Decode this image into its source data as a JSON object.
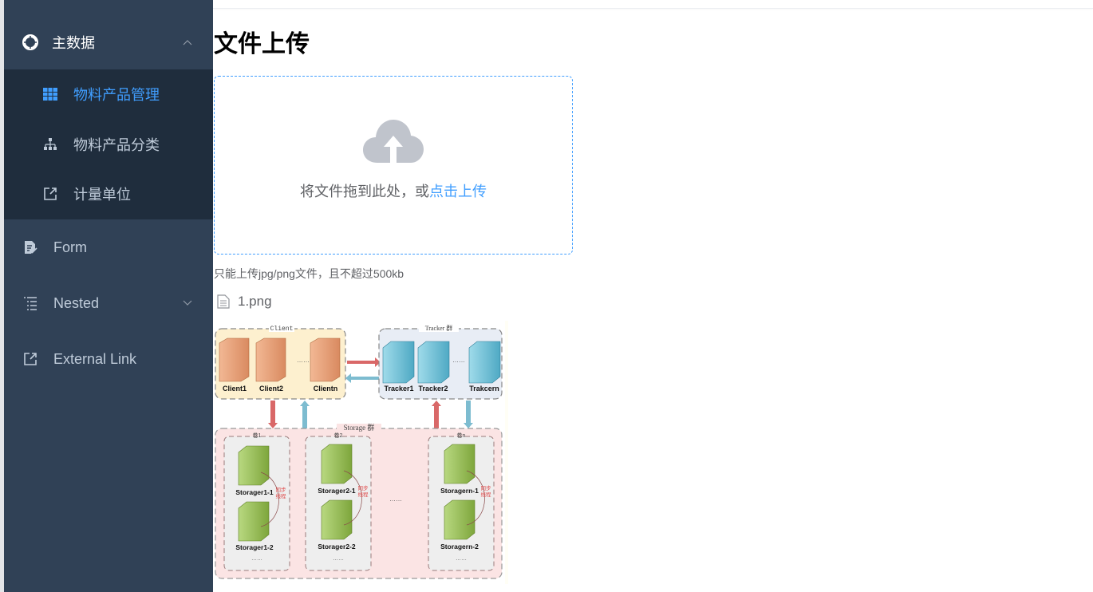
{
  "sidebar": {
    "groups": [
      {
        "label": "主数据",
        "icon": "lifebuoy-icon",
        "expanded": true,
        "children": [
          {
            "label": "物料产品管理",
            "icon": "table-icon",
            "active": true
          },
          {
            "label": "物料产品分类",
            "icon": "tree-icon",
            "active": false
          },
          {
            "label": "计量单位",
            "icon": "external-link-icon",
            "active": false
          }
        ]
      },
      {
        "label": "Form",
        "icon": "form-icon"
      },
      {
        "label": "Nested",
        "icon": "nested-list-icon",
        "expanded": false
      },
      {
        "label": "External Link",
        "icon": "external-link-icon"
      }
    ]
  },
  "main": {
    "title": "文件上传",
    "upload": {
      "drop_text": "将文件拖到此处，或",
      "click_text": "点击上传",
      "tip": "只能上传jpg/png文件，且不超过500kb"
    },
    "files": [
      {
        "name": "1.png",
        "icon": "document-icon"
      }
    ],
    "preview": {
      "client_group": "Client",
      "clients": [
        "Client1",
        "Client2",
        "Clientn"
      ],
      "tracker_group": "Tracker 群",
      "trackers": [
        "Tracker1",
        "Tracker2",
        "Trakcern"
      ],
      "storage_group": "Storage 群",
      "volumes": [
        {
          "label": "卷1",
          "nodes": [
            "Storager1-1",
            "Storager1-2"
          ]
        },
        {
          "label": "卷2",
          "nodes": [
            "Storager2-1",
            "Storager2-2"
          ]
        },
        {
          "label": "卷n",
          "nodes": [
            "Storagern-1",
            "Storagern-2"
          ]
        }
      ],
      "sync_label_1": "同步",
      "sync_label_2": "线程",
      "ellipsis": "……"
    }
  },
  "colors": {
    "sidebar_bg": "#304156",
    "submenu_bg": "#1f2d3d",
    "menu_text": "#bfcbd9",
    "accent": "#409eff"
  }
}
